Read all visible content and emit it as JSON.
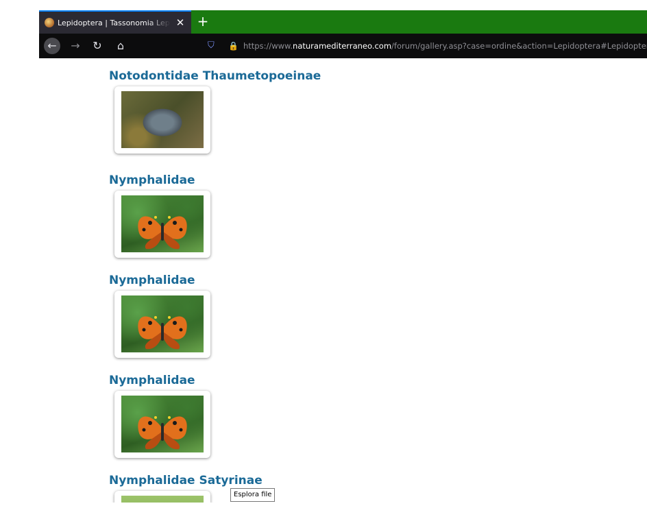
{
  "browser": {
    "tab_title": "Lepidoptera | Tassonomia Lepidoptera",
    "tab_close_symbol": "✕",
    "new_tab_symbol": "+",
    "url_prefix": "https://www.",
    "url_domain": "naturamediterraneo.com",
    "url_path": "/forum/gallery.asp?case=ordine&action=Lepidoptera#Lepidoptera",
    "icons": {
      "back": "left-arrow-icon",
      "forward": "right-arrow-icon",
      "reload": "reload-icon",
      "home": "home-icon",
      "tracking": "shield-icon",
      "security": "lock-icon"
    },
    "accent_color": "#1a7a10"
  },
  "gallery": [
    {
      "title": "Notodontidae Thaumetopoeinae",
      "image": "caterpillar-nest-photo"
    },
    {
      "title": "Nymphalidae",
      "image": "butterfly-photo"
    },
    {
      "title": "Nymphalidae",
      "image": "butterfly-photo"
    },
    {
      "title": "Nymphalidae",
      "image": "butterfly-photo"
    },
    {
      "title": "Nymphalidae Satyrinae",
      "image": "green-photo"
    }
  ],
  "tooltip": "Esplora file",
  "colors": {
    "section_title": "#1b6a97"
  }
}
